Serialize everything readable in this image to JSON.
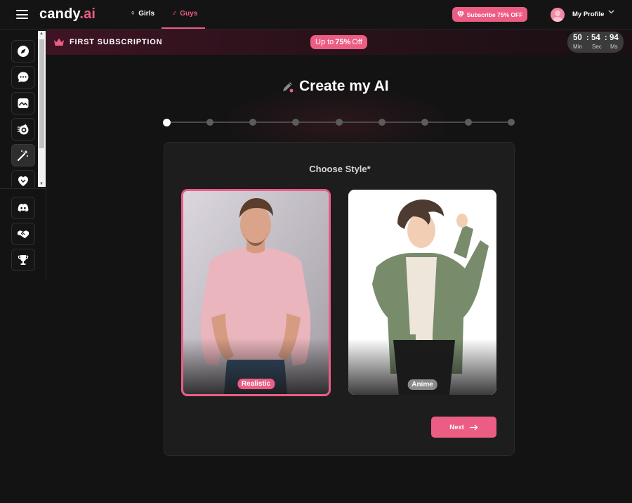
{
  "header": {
    "logo_main": "candy",
    "logo_accent": ".ai",
    "tabs": [
      {
        "label": "Girls",
        "icon": "female-icon"
      },
      {
        "label": "Guys",
        "icon": "male-icon",
        "active": true
      }
    ],
    "subscribe_label": "Subscribe 75% OFF",
    "profile_label": "My Profile"
  },
  "sidebar": {
    "items": [
      {
        "name": "explore",
        "icon": "compass-icon"
      },
      {
        "name": "chat",
        "icon": "chat-bubble-icon"
      },
      {
        "name": "gallery",
        "icon": "image-icon"
      },
      {
        "name": "generate-image",
        "icon": "camera-icon"
      },
      {
        "name": "create-character",
        "icon": "magic-wand-icon",
        "active": true
      },
      {
        "name": "my-ai",
        "icon": "heart-icon"
      }
    ],
    "bottom_items": [
      {
        "name": "discord",
        "icon": "discord-icon"
      },
      {
        "name": "affiliate",
        "icon": "handshake-icon"
      },
      {
        "name": "leaderboard",
        "icon": "trophy-icon"
      }
    ]
  },
  "promo": {
    "title": "FIRST SUBSCRIPTION",
    "pill_prefix": "Up to",
    "pill_value": "75%",
    "pill_suffix": "Off",
    "timer": {
      "minutes": "50",
      "seconds": "54",
      "ms": "94",
      "minutes_label": "Min",
      "seconds_label": "Sec",
      "ms_label": "Ms"
    }
  },
  "main": {
    "title": "Create my AI",
    "steps_total": 9,
    "current_step": 1,
    "section_title": "Choose Style*",
    "styles": [
      {
        "label": "Realistic",
        "selected": true
      },
      {
        "label": "Anime",
        "selected": false
      }
    ],
    "next_label": "Next"
  },
  "colors": {
    "accent": "#ec5d84",
    "background": "#131313",
    "card": "#1d1d1d"
  }
}
